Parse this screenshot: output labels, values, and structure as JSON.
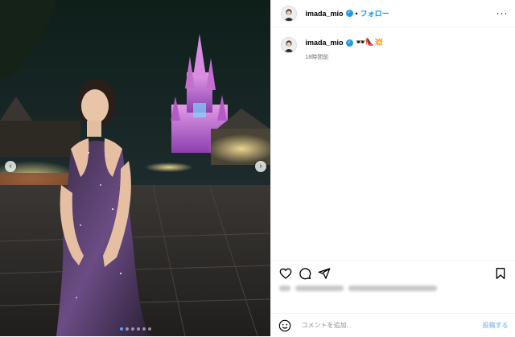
{
  "post": {
    "username": "imada_mio",
    "verified_badge": "✓",
    "separator": "•",
    "follow_label": "フォロー",
    "more_label": "···",
    "caption_emojis": "🕶👠💥",
    "time_ago": "18時間前",
    "comment_placeholder": "コメントを追加...",
    "post_label": "投稿する",
    "likes_text": "imada_mio … 他 ほか「いいね！」しました"
  },
  "carousel": {
    "prev_icon": "‹",
    "next_icon": "›",
    "slide_count": 6,
    "active_slide": 1
  },
  "icons": {
    "like": "heart-icon",
    "comment": "comment-icon",
    "share": "share-icon",
    "save": "bookmark-icon",
    "emoji": "smiley-icon",
    "more": "more-icon"
  },
  "colors": {
    "accent": "#0095f6",
    "verified": "#1d9bf0",
    "muted": "#737373",
    "post_disabled": "#9ec7f5",
    "castle": "#c86cd8"
  }
}
